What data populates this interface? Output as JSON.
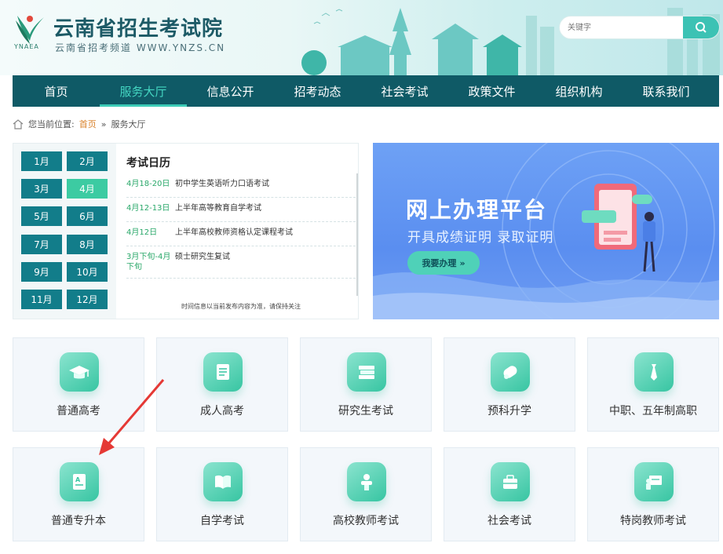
{
  "header": {
    "logo_text": "YNAEA",
    "site_title": "云南省招生考试院",
    "site_subtitle": "云南省招考频道 WWW.YNZS.CN",
    "search_placeholder": "关键字"
  },
  "nav": {
    "items": [
      "首页",
      "服务大厅",
      "信息公开",
      "招考动态",
      "社会考试",
      "政策文件",
      "组织机构",
      "联系我们"
    ],
    "active": "服务大厅"
  },
  "breadcrumb": {
    "prefix": "您当前位置:",
    "home": "首页",
    "separator": "»",
    "current": "服务大厅"
  },
  "calendar": {
    "title": "考试日历",
    "months": [
      "1月",
      "2月",
      "3月",
      "4月",
      "5月",
      "6月",
      "7月",
      "8月",
      "9月",
      "10月",
      "11月",
      "12月"
    ],
    "active_month": "4月",
    "events": [
      {
        "date": "4月18-20日",
        "name": "初中学生英语听力口语考试"
      },
      {
        "date": "4月12-13日",
        "name": "上半年高等教育自学考试"
      },
      {
        "date": "4月12日",
        "name": "上半年高校教师资格认定课程考试"
      },
      {
        "date": "3月下旬-4月下旬",
        "name": "硕士研究生复试"
      }
    ],
    "note": "时间信息以当前发布内容为准，请保持关注"
  },
  "banner": {
    "title": "网上办理平台",
    "subtitle": "开具成绩证明 录取证明",
    "button": "我要办理"
  },
  "services": [
    {
      "label": "普通高考",
      "icon": "graduation-cap-icon"
    },
    {
      "label": "成人高考",
      "icon": "scroll-icon"
    },
    {
      "label": "研究生考试",
      "icon": "books-icon"
    },
    {
      "label": "预科升学",
      "icon": "diploma-icon"
    },
    {
      "label": "中职、五年制高职",
      "icon": "tie-icon"
    },
    {
      "label": "普通专升本",
      "icon": "grade-paper-icon"
    },
    {
      "label": "自学考试",
      "icon": "open-book-icon"
    },
    {
      "label": "高校教师考试",
      "icon": "teacher-icon"
    },
    {
      "label": "社会考试",
      "icon": "briefcase-icon"
    },
    {
      "label": "特岗教师考试",
      "icon": "blackboard-icon"
    }
  ],
  "colors": {
    "nav_bg": "#0f5a66",
    "accent": "#3ccbb6",
    "month_bg": "#127d8a",
    "banner_bg": "#5a8ef0",
    "annotation_arrow": "#e53935"
  }
}
